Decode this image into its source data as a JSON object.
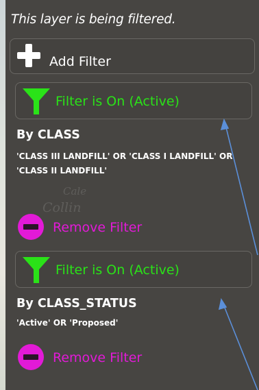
{
  "header": {
    "text": "This layer is being filtered."
  },
  "add_filter": {
    "label": "Add Filter",
    "icon": "plus-icon"
  },
  "filters": [
    {
      "status_label": "Filter is On (Active)",
      "field_label": "By CLASS",
      "criteria": "'CLASS III LANDFILL' OR 'CLASS I LANDFILL' OR 'CLASS II LANDFILL'",
      "remove_label": "Remove Filter"
    },
    {
      "status_label": "Filter is On (Active)",
      "field_label": "By CLASS_STATUS",
      "criteria": "'Active' OR 'Proposed'",
      "remove_label": "Remove Filter"
    }
  ],
  "map_ghost_text": [
    "Collin",
    "Cale"
  ],
  "colors": {
    "panel": "#474542",
    "active_green": "#2ae218",
    "remove_magenta": "#e21ad7",
    "arrow": "#5b8fd9"
  }
}
